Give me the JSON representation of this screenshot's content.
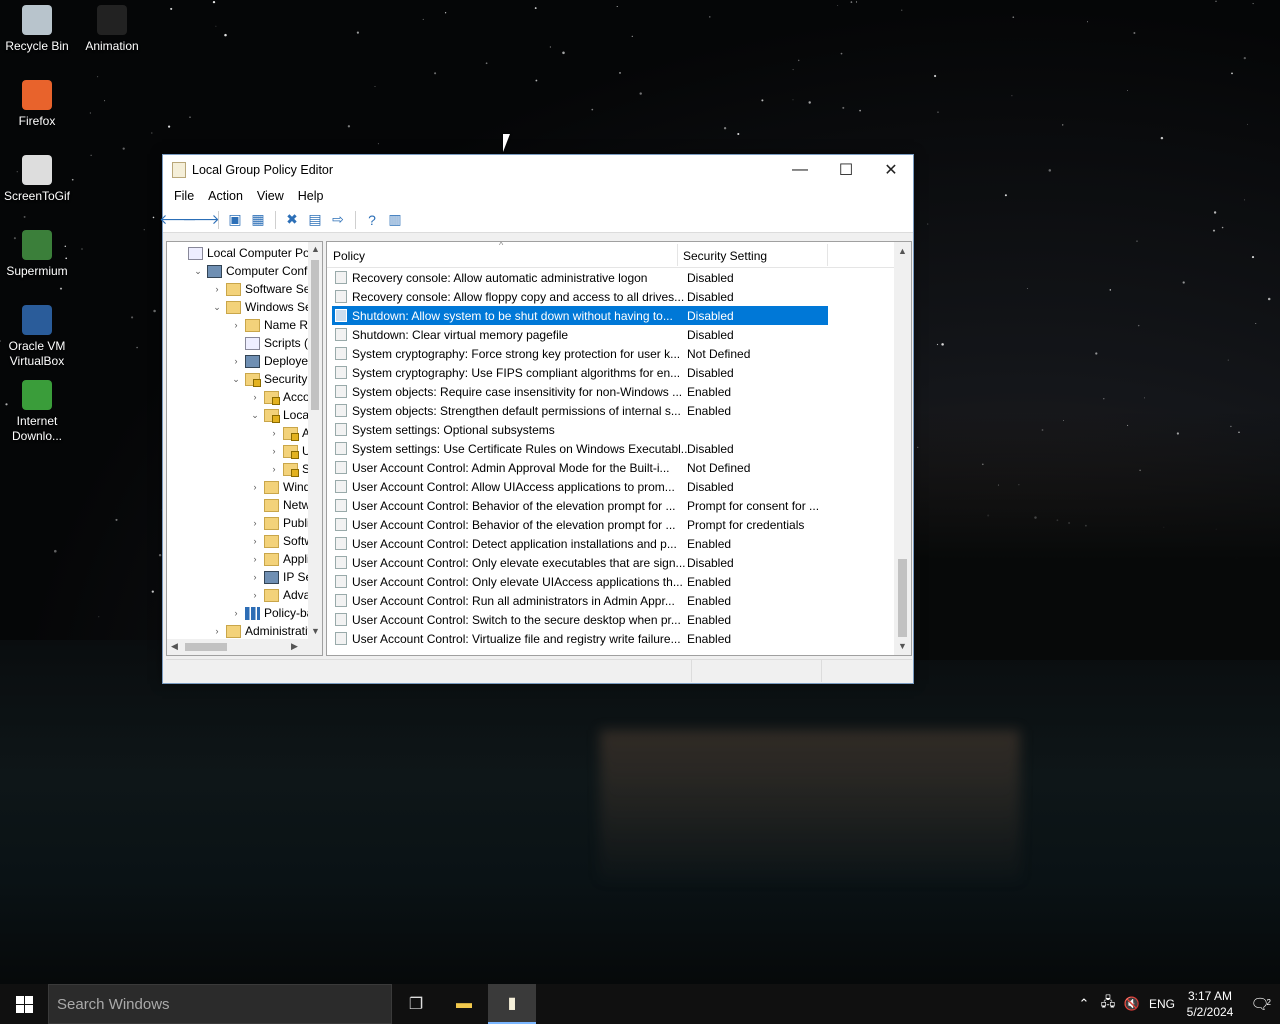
{
  "desktop": {
    "icons": [
      {
        "label": "Recycle Bin",
        "icon": "recycle-bin-icon",
        "color": "#b8c4cc"
      },
      {
        "label": "Animation",
        "icon": "animation-icon",
        "color": "#222222"
      },
      {
        "label": "Firefox",
        "icon": "firefox-icon",
        "color": "#e8632c"
      },
      {
        "label": "ScreenToGif",
        "icon": "screentogif-icon",
        "color": "#dddddd"
      },
      {
        "label": "Supermium",
        "icon": "supermium-icon",
        "color": "#3b7f3a"
      },
      {
        "label": "Oracle VM VirtualBox",
        "icon": "virtualbox-icon",
        "color": "#2a5c9a"
      },
      {
        "label": "Internet Downlo...",
        "icon": "internet-download-manager-icon",
        "color": "#3a9d3a"
      }
    ]
  },
  "window": {
    "title": "Local Group Policy Editor",
    "controls": {
      "minimize": "—",
      "maximize": "☐",
      "close": "✕"
    },
    "menu": [
      "File",
      "Action",
      "View",
      "Help"
    ],
    "toolbar": [
      {
        "icon": "back-arrow-icon",
        "glyph": "🡐"
      },
      {
        "icon": "forward-arrow-icon",
        "glyph": "🡒"
      },
      {
        "icon": "up-folder-icon",
        "glyph": "▣"
      },
      {
        "icon": "show-hide-tree-icon",
        "glyph": "▦"
      },
      {
        "icon": "delete-icon",
        "glyph": "✖"
      },
      {
        "icon": "properties-icon",
        "glyph": "▤"
      },
      {
        "icon": "export-list-icon",
        "glyph": "⇨"
      },
      {
        "icon": "help-icon",
        "glyph": "?"
      },
      {
        "icon": "show-action-pane-icon",
        "glyph": "▥"
      }
    ],
    "tree": [
      {
        "label": "Local Computer Polic",
        "indent": 0,
        "arrow": "",
        "icon": "doc"
      },
      {
        "label": "Computer Config",
        "indent": 1,
        "arrow": "⌄",
        "icon": "pc"
      },
      {
        "label": "Software Setti",
        "indent": 2,
        "arrow": "›",
        "icon": "folder"
      },
      {
        "label": "Windows Sett",
        "indent": 2,
        "arrow": "⌄",
        "icon": "folder"
      },
      {
        "label": "Name Res",
        "indent": 3,
        "arrow": "›",
        "icon": "folder"
      },
      {
        "label": "Scripts (Sta",
        "indent": 3,
        "arrow": "",
        "icon": "doc"
      },
      {
        "label": "Deployed",
        "indent": 3,
        "arrow": "›",
        "icon": "pc"
      },
      {
        "label": "Security Se",
        "indent": 3,
        "arrow": "⌄",
        "icon": "lock"
      },
      {
        "label": "Accou",
        "indent": 4,
        "arrow": "›",
        "icon": "lock"
      },
      {
        "label": "Local F",
        "indent": 4,
        "arrow": "⌄",
        "icon": "lock"
      },
      {
        "label": "Au",
        "indent": 5,
        "arrow": "›",
        "icon": "lock"
      },
      {
        "label": "Use",
        "indent": 5,
        "arrow": "›",
        "icon": "lock"
      },
      {
        "label": "Sec",
        "indent": 5,
        "arrow": "›",
        "icon": "lock"
      },
      {
        "label": "Windo",
        "indent": 4,
        "arrow": "›",
        "icon": "folder"
      },
      {
        "label": "Netwo",
        "indent": 4,
        "arrow": "",
        "icon": "folder"
      },
      {
        "label": "Public",
        "indent": 4,
        "arrow": "›",
        "icon": "folder"
      },
      {
        "label": "Softwa",
        "indent": 4,
        "arrow": "›",
        "icon": "folder"
      },
      {
        "label": "Applic",
        "indent": 4,
        "arrow": "›",
        "icon": "folder"
      },
      {
        "label": "IP Secu",
        "indent": 4,
        "arrow": "›",
        "icon": "pc"
      },
      {
        "label": "Advan",
        "indent": 4,
        "arrow": "›",
        "icon": "folder"
      },
      {
        "label": "Policy-bas",
        "indent": 3,
        "arrow": "›",
        "icon": "chart"
      },
      {
        "label": "Administrativ",
        "indent": 2,
        "arrow": "›",
        "icon": "folder"
      }
    ],
    "columns": {
      "policy": "Policy",
      "setting": "Security Setting"
    },
    "selected_index": 2,
    "policies": [
      {
        "name": "Recovery console: Allow automatic administrative logon",
        "value": "Disabled"
      },
      {
        "name": "Recovery console: Allow floppy copy and access to all drives...",
        "value": "Disabled"
      },
      {
        "name": "Shutdown: Allow system to be shut down without having to...",
        "value": "Disabled"
      },
      {
        "name": "Shutdown: Clear virtual memory pagefile",
        "value": "Disabled"
      },
      {
        "name": "System cryptography: Force strong key protection for user k...",
        "value": "Not Defined"
      },
      {
        "name": "System cryptography: Use FIPS compliant algorithms for en...",
        "value": "Disabled"
      },
      {
        "name": "System objects: Require case insensitivity for non-Windows ...",
        "value": "Enabled"
      },
      {
        "name": "System objects: Strengthen default permissions of internal s...",
        "value": "Enabled"
      },
      {
        "name": "System settings: Optional subsystems",
        "value": ""
      },
      {
        "name": "System settings: Use Certificate Rules on Windows Executabl...",
        "value": "Disabled"
      },
      {
        "name": "User Account Control: Admin Approval Mode for the Built-i...",
        "value": "Not Defined"
      },
      {
        "name": "User Account Control: Allow UIAccess applications to prom...",
        "value": "Disabled"
      },
      {
        "name": "User Account Control: Behavior of the elevation prompt for ...",
        "value": "Prompt for consent for ..."
      },
      {
        "name": "User Account Control: Behavior of the elevation prompt for ...",
        "value": "Prompt for credentials"
      },
      {
        "name": "User Account Control: Detect application installations and p...",
        "value": "Enabled"
      },
      {
        "name": "User Account Control: Only elevate executables that are sign...",
        "value": "Disabled"
      },
      {
        "name": "User Account Control: Only elevate UIAccess applications th...",
        "value": "Enabled"
      },
      {
        "name": "User Account Control: Run all administrators in Admin Appr...",
        "value": "Enabled"
      },
      {
        "name": "User Account Control: Switch to the secure desktop when pr...",
        "value": "Enabled"
      },
      {
        "name": "User Account Control: Virtualize file and registry write failure...",
        "value": "Enabled"
      }
    ]
  },
  "taskbar": {
    "search_placeholder": "Search Windows",
    "language": "ENG",
    "time": "3:17 AM",
    "date": "5/2/2024",
    "notification_count": "2"
  }
}
